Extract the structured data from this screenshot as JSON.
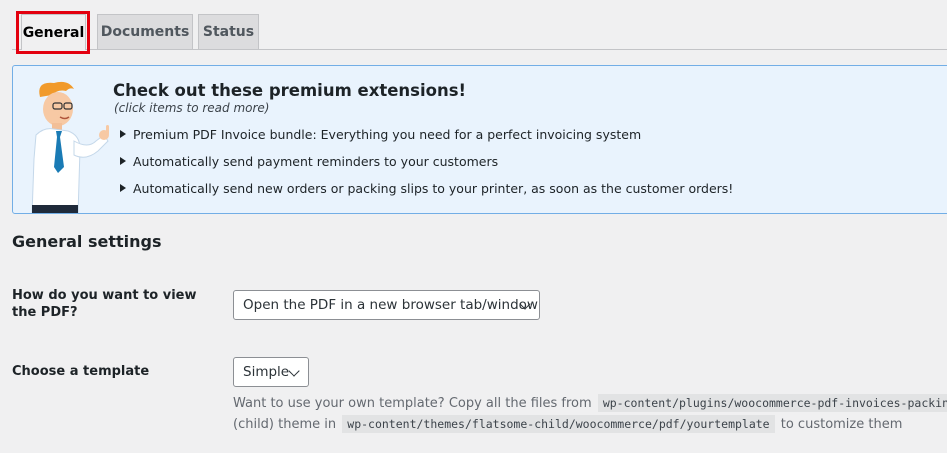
{
  "tabs": [
    {
      "label": "General",
      "active": true
    },
    {
      "label": "Documents",
      "active": false
    },
    {
      "label": "Status",
      "active": false
    }
  ],
  "extensions": {
    "title": "Check out these premium extensions!",
    "subtitle": "(click items to read more)",
    "items": [
      "Premium PDF Invoice bundle: Everything you need for a perfect invoicing system",
      "Automatically send payment reminders to your customers",
      "Automatically send new orders or packing slips to your printer, as soon as the customer orders!"
    ]
  },
  "general": {
    "title": "General settings",
    "view_pdf": {
      "label": "How do you want to view the PDF?",
      "value": "Open the PDF in a new browser tab/window"
    },
    "template": {
      "label": "Choose a template",
      "value": "Simple",
      "description": {
        "text1": "Want to use your own template? Copy all the files from",
        "code1": "wp-content/plugins/woocommerce-pdf-invoices-packing",
        "text2": "(child) theme in",
        "code2": "wp-content/themes/flatsome-child/woocommerce/pdf/yourtemplate",
        "text3": "to customize them"
      }
    }
  },
  "colors": {
    "highlight": "#e3000f",
    "panel_border": "#72aee6",
    "panel_bg": "#e9f3fd"
  }
}
